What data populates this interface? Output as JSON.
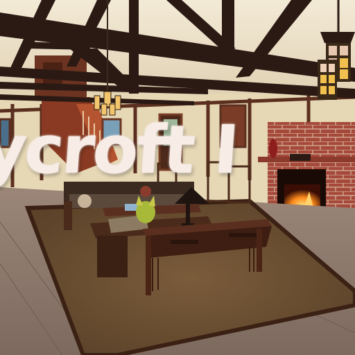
{
  "scene": {
    "title": "ycroft I",
    "title_color": "#f7ece6"
  },
  "palette": {
    "ceiling": "#efe5cf",
    "beam": "#2b1a14",
    "wall": "#e7d8b5",
    "wood_trim": "#5b2f1f",
    "floor": "#8a7569",
    "rug": "#6e5233",
    "brick": "#a54a3b",
    "fire": "#ff9a2a",
    "lamp_glow": "#f3c66e"
  }
}
